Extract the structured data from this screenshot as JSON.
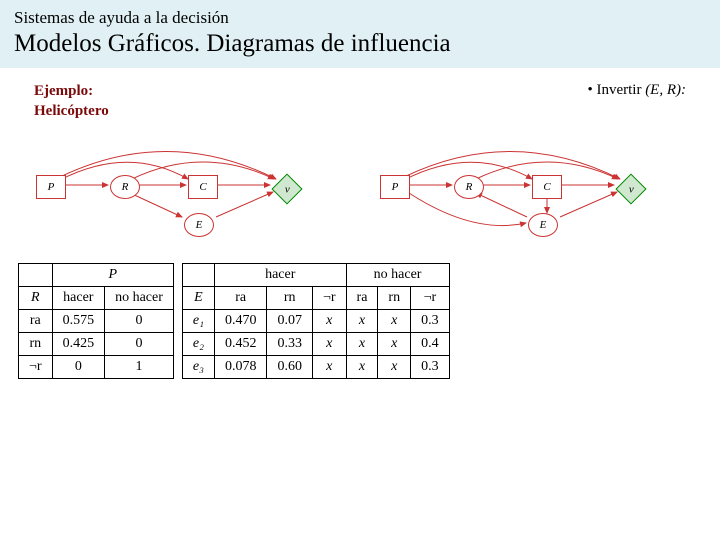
{
  "header": {
    "subtitle": "Sistemas de ayuda a la decisión",
    "title": "Modelos Gráficos. Diagramas de influencia"
  },
  "labels": {
    "ejemplo_l1": "Ejemplo:",
    "ejemplo_l2": "Helicóptero",
    "invertir_bullet": "• Invertir ",
    "invertir_args": "(E, R):"
  },
  "diagram_nodes": {
    "P": "P",
    "R": "R",
    "C": "C",
    "v": "v",
    "E": "E"
  },
  "table_left": {
    "head_blank": "",
    "head_P": "P",
    "col_R": "R",
    "col_hacer": "hacer",
    "col_nohacer": "no hacer",
    "rows": [
      {
        "r": "ra",
        "hacer": "0.575",
        "nohacer": "0"
      },
      {
        "r": "rn",
        "hacer": "0.425",
        "nohacer": "0"
      },
      {
        "r": "¬r",
        "hacer": "0",
        "nohacer": "1"
      }
    ]
  },
  "table_right": {
    "head_blank": "",
    "head_hacer": "hacer",
    "head_nohacer": "no hacer",
    "col_E": "E",
    "sub_ra": "ra",
    "sub_rn": "rn",
    "sub_negr": "¬r",
    "rows": [
      {
        "e": "e₁",
        "ra1": "0.470",
        "rn1": "0.07",
        "nr1": "x",
        "ra2": "x",
        "rn2": "x",
        "nr2": "0.3"
      },
      {
        "e": "e₂",
        "ra1": "0.452",
        "rn1": "0.33",
        "nr1": "x",
        "ra2": "x",
        "rn2": "x",
        "nr2": "0.4"
      },
      {
        "e": "e₃",
        "ra1": "0.078",
        "rn1": "0.60",
        "nr1": "x",
        "ra2": "x",
        "rn2": "x",
        "nr2": "0.3"
      }
    ]
  }
}
